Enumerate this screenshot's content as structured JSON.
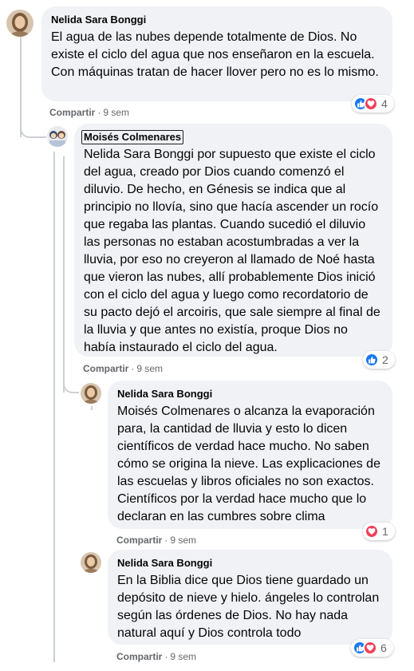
{
  "comments": [
    {
      "author": "Nelida Sara Bonggi",
      "text": "El agua de las nubes depende totalmente de Dios. No existe el ciclo del agua que nos enseñaron en la escuela. Con máquinas tratan de hacer llover pero no es lo mismo.",
      "action_label": "Compartir",
      "separator": "·",
      "time": "9 sem",
      "reaction_icons": [
        "like-icon",
        "love-icon"
      ],
      "reaction_count": "4"
    },
    {
      "author": "Moisés Colmenares",
      "text": "Nelida Sara Bonggi por supuesto que existe el ciclo del agua, creado por Dios cuando comenzó el diluvio. De hecho, en Génesis se indica que al principio no llovía, sino que hacía ascender un rocío que regaba las plantas. Cuando sucedió el diluvio las personas no estaban acostumbradas a ver la lluvia, por eso no creyeron al llamado de Noé hasta que vieron las nubes, allí probablemente Dios inició con el ciclo del agua y luego como recordatorio de su pacto dejó el arcoiris, que sale siempre al final de la lluvia y que antes no existía, proque Dios no había instaurado el ciclo del agua.",
      "action_label": "Compartir",
      "separator": "·",
      "time": "9 sem",
      "reaction_icons": [
        "like-icon"
      ],
      "reaction_count": "2"
    },
    {
      "author": "Nelida Sara Bonggi",
      "text": "Moisés Colmenares o alcanza la evaporación para, la cantidad de lluvia y esto lo dicen científicos de verdad hace mucho. No saben cómo se origina la nieve. Las explicaciones de las escuelas y libros oficiales no son exactos. Científicos por la verdad hace mucho que lo declaran en las cumbres sobre clima",
      "action_label": "Compartir",
      "separator": "·",
      "time": "9 sem",
      "reaction_icons": [
        "love-icon"
      ],
      "reaction_count": "1"
    },
    {
      "author": "Nelida Sara Bonggi",
      "text": "En la Biblia dice que Dios tiene guardado un depósito de nieve y hielo. ángeles lo controlan según las órdenes de Dios. No hay nada natural aquí y Dios controla todo",
      "action_label": "Compartir",
      "separator": "·",
      "time": "9 sem",
      "reaction_icons": [
        "like-icon",
        "love-icon"
      ],
      "reaction_count": "6"
    }
  ],
  "colors": {
    "bubble": "#f0f2f5",
    "meta_text": "#65676b",
    "like": "#1877f2",
    "love": "#f33e58",
    "thread_line": "#ccd0d5"
  }
}
